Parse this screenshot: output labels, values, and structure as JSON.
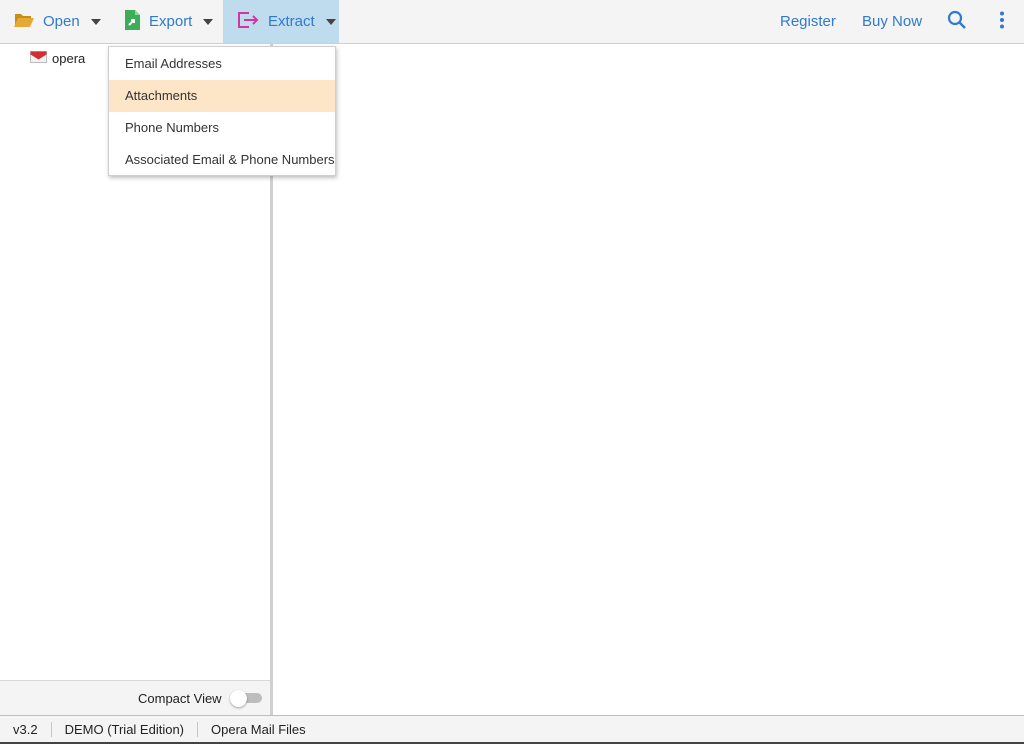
{
  "toolbar": {
    "open_label": "Open",
    "export_label": "Export",
    "extract_label": "Extract",
    "register_label": "Register",
    "buy_now_label": "Buy Now",
    "icons": {
      "open": "folder-open-icon",
      "export": "file-export-icon",
      "extract": "sign-out-icon",
      "search": "search-icon",
      "more": "more-vertical-icon"
    }
  },
  "extract_menu": {
    "items": [
      {
        "label": "Email Addresses",
        "highlighted": false
      },
      {
        "label": "Attachments",
        "highlighted": true
      },
      {
        "label": "Phone Numbers",
        "highlighted": false
      },
      {
        "label": "Associated Email & Phone Numbers",
        "highlighted": false
      }
    ]
  },
  "tree": {
    "items": [
      {
        "label": "opera",
        "icon": "envelope-icon"
      }
    ]
  },
  "compact_view": {
    "label": "Compact View",
    "enabled": false
  },
  "statusbar": {
    "version": "v3.2",
    "edition": "DEMO (Trial Edition)",
    "file_type": "Opera Mail Files"
  },
  "colors": {
    "accent": "#2f7ad0",
    "extract_active_bg": "#bfdcef",
    "menu_hover_bg": "#fde5c8",
    "open_icon": "#e0a42b",
    "export_icon": "#3cae5a",
    "extract_icon": "#d1359e"
  }
}
